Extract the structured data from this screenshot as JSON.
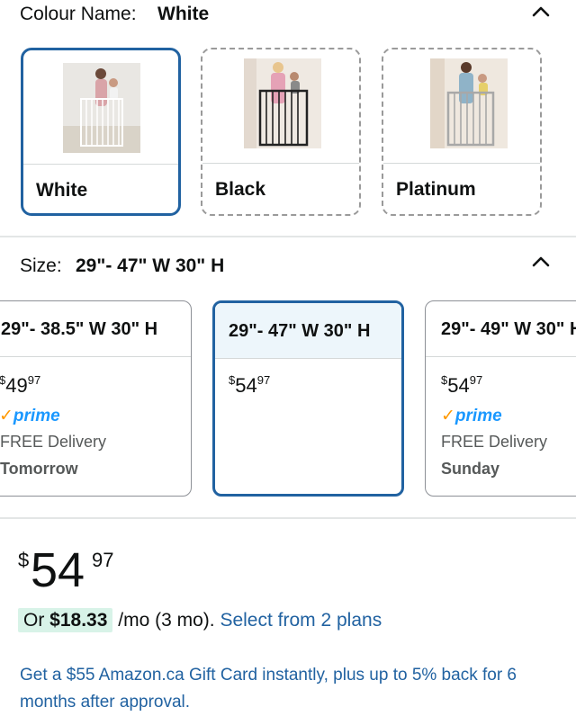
{
  "colour": {
    "label": "Colour Name:",
    "value": "White",
    "options": [
      {
        "name": "White",
        "selected": true
      },
      {
        "name": "Black",
        "selected": false
      },
      {
        "name": "Platinum",
        "selected": false
      }
    ]
  },
  "size": {
    "label": "Size:",
    "value": "29\"- 47\" W 30\" H",
    "options": [
      {
        "title": "29\"- 38.5\" W 30\" H",
        "price_symbol": "$",
        "price_whole": "49",
        "price_cents": "97",
        "prime": "prime",
        "delivery": "FREE Delivery",
        "delivery_day": "Tomorrow",
        "selected": false
      },
      {
        "title": "29\"- 47\" W 30\" H",
        "price_symbol": "$",
        "price_whole": "54",
        "price_cents": "97",
        "selected": true
      },
      {
        "title": "29\"- 49\" W 30\" H",
        "price_symbol": "$",
        "price_whole": "54",
        "price_cents": "97",
        "prime": "prime",
        "delivery": "FREE Delivery",
        "delivery_day": "Sunday",
        "selected": false
      }
    ]
  },
  "price": {
    "symbol": "$",
    "whole": "54",
    "cents": "97"
  },
  "plans": {
    "prefix": "Or ",
    "amount": "$18.33",
    "suffix": " /mo (3 mo). ",
    "link": "Select from 2 plans"
  },
  "gift_text": "Get a $55 Amazon.ca Gift Card instantly, plus up to 5% back for 6 months after approval.",
  "colors": {
    "accent_blue": "#2162a1",
    "prime_blue": "#1a98ff",
    "prime_check": "#ff9900",
    "plan_highlight": "#d8f3e8"
  }
}
